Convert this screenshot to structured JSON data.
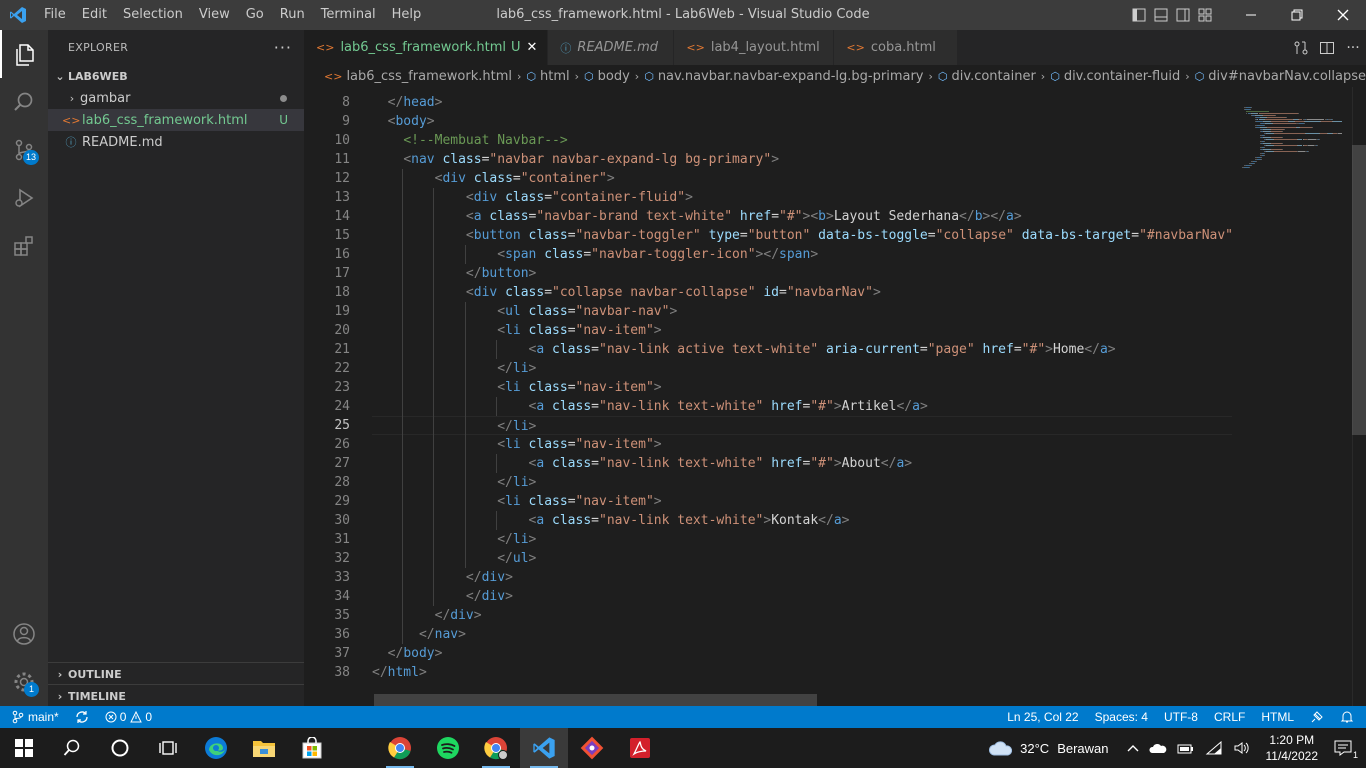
{
  "window": {
    "title": "lab6_css_framework.html - Lab6Web - Visual Studio Code",
    "menu": [
      "File",
      "Edit",
      "Selection",
      "View",
      "Go",
      "Run",
      "Terminal",
      "Help"
    ]
  },
  "activity": {
    "scm_badge": "13",
    "settings_badge": "1"
  },
  "explorer": {
    "title": "EXPLORER",
    "more": "···",
    "project": "LAB6WEB",
    "items": [
      {
        "label": "gambar",
        "type": "folder"
      },
      {
        "label": "lab6_css_framework.html",
        "type": "html",
        "status": "U"
      },
      {
        "label": "README.md",
        "type": "md"
      }
    ],
    "outline": "OUTLINE",
    "timeline": "TIMELINE"
  },
  "tabs": [
    {
      "label": "lab6_css_framework.html",
      "status": "U",
      "close": "✕"
    },
    {
      "label": "README.md"
    },
    {
      "label": "lab4_layout.html"
    },
    {
      "label": "coba.html"
    }
  ],
  "breadcrumb": [
    "lab6_css_framework.html",
    "html",
    "body",
    "nav.navbar.navbar-expand-lg.bg-primary",
    "div.container",
    "div.container-fluid",
    "div#navbarNav.collapse.navbar-colla"
  ],
  "editor": {
    "current_line": 25,
    "line_numbers": [
      "8",
      "9",
      "10",
      "11",
      "12",
      "13",
      "14",
      "15",
      "16",
      "17",
      "18",
      "19",
      "20",
      "21",
      "22",
      "23",
      "24",
      "25",
      "26",
      "27",
      "28",
      "29",
      "30",
      "31",
      "32",
      "33",
      "34",
      "35",
      "36",
      "37",
      "38"
    ],
    "lines": [
      {
        "indent": 2,
        "tokens": [
          [
            "p",
            "</"
          ],
          [
            "t",
            "head"
          ],
          [
            "p",
            ">"
          ]
        ]
      },
      {
        "indent": 2,
        "tokens": [
          [
            "p",
            "<"
          ],
          [
            "t",
            "body"
          ],
          [
            "p",
            ">"
          ]
        ]
      },
      {
        "indent": 4,
        "tokens": [
          [
            "c",
            "<!--Membuat Navbar-->"
          ]
        ]
      },
      {
        "indent": 4,
        "tokens": [
          [
            "p",
            "<"
          ],
          [
            "t",
            "nav"
          ],
          [
            "x",
            " "
          ],
          [
            "a",
            "class"
          ],
          [
            "x",
            "="
          ],
          [
            "s",
            "\"navbar navbar-expand-lg bg-primary\""
          ],
          [
            "p",
            ">"
          ]
        ]
      },
      {
        "indent": 8,
        "tokens": [
          [
            "p",
            "<"
          ],
          [
            "t",
            "div"
          ],
          [
            "x",
            " "
          ],
          [
            "a",
            "class"
          ],
          [
            "x",
            "="
          ],
          [
            "s",
            "\"container\""
          ],
          [
            "p",
            ">"
          ]
        ]
      },
      {
        "indent": 12,
        "tokens": [
          [
            "p",
            "<"
          ],
          [
            "t",
            "div"
          ],
          [
            "x",
            " "
          ],
          [
            "a",
            "class"
          ],
          [
            "x",
            "="
          ],
          [
            "s",
            "\"container-fluid\""
          ],
          [
            "p",
            ">"
          ]
        ]
      },
      {
        "indent": 12,
        "tokens": [
          [
            "p",
            "<"
          ],
          [
            "t",
            "a"
          ],
          [
            "x",
            " "
          ],
          [
            "a",
            "class"
          ],
          [
            "x",
            "="
          ],
          [
            "s",
            "\"navbar-brand text-white\""
          ],
          [
            "x",
            " "
          ],
          [
            "a",
            "href"
          ],
          [
            "x",
            "="
          ],
          [
            "s",
            "\"#\""
          ],
          [
            "p",
            "><"
          ],
          [
            "t",
            "b"
          ],
          [
            "p",
            ">"
          ],
          [
            "x",
            "Layout Sederhana"
          ],
          [
            "p",
            "</"
          ],
          [
            "t",
            "b"
          ],
          [
            "p",
            "></"
          ],
          [
            "t",
            "a"
          ],
          [
            "p",
            ">"
          ]
        ]
      },
      {
        "indent": 12,
        "tokens": [
          [
            "p",
            "<"
          ],
          [
            "t",
            "button"
          ],
          [
            "x",
            " "
          ],
          [
            "a",
            "class"
          ],
          [
            "x",
            "="
          ],
          [
            "s",
            "\"navbar-toggler\""
          ],
          [
            "x",
            " "
          ],
          [
            "a",
            "type"
          ],
          [
            "x",
            "="
          ],
          [
            "s",
            "\"button\""
          ],
          [
            "x",
            " "
          ],
          [
            "a",
            "data-bs-toggle"
          ],
          [
            "x",
            "="
          ],
          [
            "s",
            "\"collapse\""
          ],
          [
            "x",
            " "
          ],
          [
            "a",
            "data-bs-target"
          ],
          [
            "x",
            "="
          ],
          [
            "s",
            "\"#navbarNav\""
          ],
          [
            "x",
            " "
          ],
          [
            "a",
            "a"
          ]
        ]
      },
      {
        "indent": 16,
        "tokens": [
          [
            "p",
            "<"
          ],
          [
            "t",
            "span"
          ],
          [
            "x",
            " "
          ],
          [
            "a",
            "class"
          ],
          [
            "x",
            "="
          ],
          [
            "s",
            "\"navbar-toggler-icon\""
          ],
          [
            "p",
            "></"
          ],
          [
            "t",
            "span"
          ],
          [
            "p",
            ">"
          ]
        ]
      },
      {
        "indent": 12,
        "tokens": [
          [
            "p",
            "</"
          ],
          [
            "t",
            "button"
          ],
          [
            "p",
            ">"
          ]
        ]
      },
      {
        "indent": 12,
        "tokens": [
          [
            "p",
            "<"
          ],
          [
            "t",
            "div"
          ],
          [
            "x",
            " "
          ],
          [
            "a",
            "class"
          ],
          [
            "x",
            "="
          ],
          [
            "s",
            "\"collapse navbar-collapse\""
          ],
          [
            "x",
            " "
          ],
          [
            "a",
            "id"
          ],
          [
            "x",
            "="
          ],
          [
            "s",
            "\"navbarNav\""
          ],
          [
            "p",
            ">"
          ]
        ]
      },
      {
        "indent": 16,
        "tokens": [
          [
            "p",
            "<"
          ],
          [
            "t",
            "ul"
          ],
          [
            "x",
            " "
          ],
          [
            "a",
            "class"
          ],
          [
            "x",
            "="
          ],
          [
            "s",
            "\"navbar-nav\""
          ],
          [
            "p",
            ">"
          ]
        ]
      },
      {
        "indent": 16,
        "tokens": [
          [
            "p",
            "<"
          ],
          [
            "t",
            "li"
          ],
          [
            "x",
            " "
          ],
          [
            "a",
            "class"
          ],
          [
            "x",
            "="
          ],
          [
            "s",
            "\"nav-item\""
          ],
          [
            "p",
            ">"
          ]
        ]
      },
      {
        "indent": 20,
        "tokens": [
          [
            "p",
            "<"
          ],
          [
            "t",
            "a"
          ],
          [
            "x",
            " "
          ],
          [
            "a",
            "class"
          ],
          [
            "x",
            "="
          ],
          [
            "s",
            "\"nav-link active text-white\""
          ],
          [
            "x",
            " "
          ],
          [
            "a",
            "aria-current"
          ],
          [
            "x",
            "="
          ],
          [
            "s",
            "\"page\""
          ],
          [
            "x",
            " "
          ],
          [
            "a",
            "href"
          ],
          [
            "x",
            "="
          ],
          [
            "s",
            "\"#\""
          ],
          [
            "p",
            ">"
          ],
          [
            "x",
            "Home"
          ],
          [
            "p",
            "</"
          ],
          [
            "t",
            "a"
          ],
          [
            "p",
            ">"
          ]
        ]
      },
      {
        "indent": 16,
        "tokens": [
          [
            "p",
            "</"
          ],
          [
            "t",
            "li"
          ],
          [
            "p",
            ">"
          ]
        ]
      },
      {
        "indent": 16,
        "tokens": [
          [
            "p",
            "<"
          ],
          [
            "t",
            "li"
          ],
          [
            "x",
            " "
          ],
          [
            "a",
            "class"
          ],
          [
            "x",
            "="
          ],
          [
            "s",
            "\"nav-item\""
          ],
          [
            "p",
            ">"
          ]
        ]
      },
      {
        "indent": 20,
        "tokens": [
          [
            "p",
            "<"
          ],
          [
            "t",
            "a"
          ],
          [
            "x",
            " "
          ],
          [
            "a",
            "class"
          ],
          [
            "x",
            "="
          ],
          [
            "s",
            "\"nav-link text-white\""
          ],
          [
            "x",
            " "
          ],
          [
            "a",
            "href"
          ],
          [
            "x",
            "="
          ],
          [
            "s",
            "\"#\""
          ],
          [
            "p",
            ">"
          ],
          [
            "x",
            "Artikel"
          ],
          [
            "p",
            "</"
          ],
          [
            "t",
            "a"
          ],
          [
            "p",
            ">"
          ]
        ]
      },
      {
        "indent": 16,
        "tokens": [
          [
            "p",
            "</"
          ],
          [
            "t",
            "li"
          ],
          [
            "p",
            ">"
          ]
        ]
      },
      {
        "indent": 16,
        "tokens": [
          [
            "p",
            "<"
          ],
          [
            "t",
            "li"
          ],
          [
            "x",
            " "
          ],
          [
            "a",
            "class"
          ],
          [
            "x",
            "="
          ],
          [
            "s",
            "\"nav-item\""
          ],
          [
            "p",
            ">"
          ]
        ]
      },
      {
        "indent": 20,
        "tokens": [
          [
            "p",
            "<"
          ],
          [
            "t",
            "a"
          ],
          [
            "x",
            " "
          ],
          [
            "a",
            "class"
          ],
          [
            "x",
            "="
          ],
          [
            "s",
            "\"nav-link text-white\""
          ],
          [
            "x",
            " "
          ],
          [
            "a",
            "href"
          ],
          [
            "x",
            "="
          ],
          [
            "s",
            "\"#\""
          ],
          [
            "p",
            ">"
          ],
          [
            "x",
            "About"
          ],
          [
            "p",
            "</"
          ],
          [
            "t",
            "a"
          ],
          [
            "p",
            ">"
          ]
        ]
      },
      {
        "indent": 16,
        "tokens": [
          [
            "p",
            "</"
          ],
          [
            "t",
            "li"
          ],
          [
            "p",
            ">"
          ]
        ]
      },
      {
        "indent": 16,
        "tokens": [
          [
            "p",
            "<"
          ],
          [
            "t",
            "li"
          ],
          [
            "x",
            " "
          ],
          [
            "a",
            "class"
          ],
          [
            "x",
            "="
          ],
          [
            "s",
            "\"nav-item\""
          ],
          [
            "p",
            ">"
          ]
        ]
      },
      {
        "indent": 20,
        "tokens": [
          [
            "p",
            "<"
          ],
          [
            "t",
            "a"
          ],
          [
            "x",
            " "
          ],
          [
            "a",
            "class"
          ],
          [
            "x",
            "="
          ],
          [
            "s",
            "\"nav-link text-white\""
          ],
          [
            "p",
            ">"
          ],
          [
            "x",
            "Kontak"
          ],
          [
            "p",
            "</"
          ],
          [
            "t",
            "a"
          ],
          [
            "p",
            ">"
          ]
        ]
      },
      {
        "indent": 16,
        "tokens": [
          [
            "p",
            "</"
          ],
          [
            "t",
            "li"
          ],
          [
            "p",
            ">"
          ]
        ]
      },
      {
        "indent": 16,
        "tokens": [
          [
            "p",
            "</"
          ],
          [
            "t",
            "ul"
          ],
          [
            "p",
            ">"
          ]
        ]
      },
      {
        "indent": 12,
        "tokens": [
          [
            "p",
            "</"
          ],
          [
            "t",
            "div"
          ],
          [
            "p",
            ">"
          ]
        ]
      },
      {
        "indent": 12,
        "tokens": [
          [
            "p",
            "</"
          ],
          [
            "t",
            "div"
          ],
          [
            "p",
            ">"
          ]
        ]
      },
      {
        "indent": 8,
        "tokens": [
          [
            "p",
            "</"
          ],
          [
            "t",
            "div"
          ],
          [
            "p",
            ">"
          ]
        ]
      },
      {
        "indent": 6,
        "tokens": [
          [
            "p",
            "</"
          ],
          [
            "t",
            "nav"
          ],
          [
            "p",
            ">"
          ]
        ]
      },
      {
        "indent": 2,
        "tokens": [
          [
            "p",
            "</"
          ],
          [
            "t",
            "body"
          ],
          [
            "p",
            ">"
          ]
        ]
      },
      {
        "indent": 0,
        "tokens": [
          [
            "p",
            "</"
          ],
          [
            "t",
            "html"
          ],
          [
            "p",
            ">"
          ]
        ]
      }
    ]
  },
  "status": {
    "branch": "main*",
    "errors": "0",
    "warnings": "0",
    "position": "Ln 25, Col 22",
    "spaces": "Spaces: 4",
    "encoding": "UTF-8",
    "eol": "CRLF",
    "language": "HTML"
  },
  "taskbar": {
    "temperature": "32°C",
    "weather": "Berawan",
    "time": "1:20 PM",
    "date": "11/4/2022",
    "notif_count": "1"
  },
  "colors": {
    "accent": "#007acc",
    "tag": "#569cd6",
    "attr": "#9cdcfe",
    "string": "#ce9178",
    "comment": "#6a9955"
  }
}
